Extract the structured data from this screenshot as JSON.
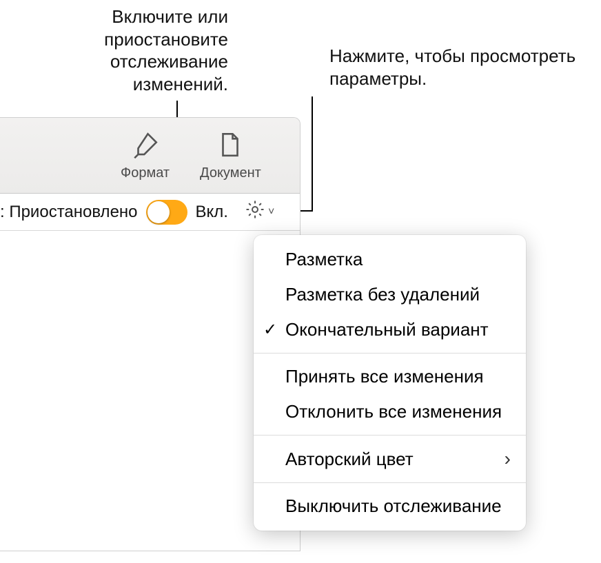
{
  "callouts": {
    "left": "Включите или приостановите отслеживание изменений.",
    "right": "Нажмите, чтобы просмотреть параметры."
  },
  "toolbar": {
    "format": "Формат",
    "document": "Документ"
  },
  "trackbar": {
    "paused": ": Приостановлено",
    "on": "Вкл."
  },
  "menu": {
    "items": {
      "markup": "Разметка",
      "markup_no_del": "Разметка без удалений",
      "final": "Окончательный вариант",
      "accept_all": "Принять все изменения",
      "reject_all": "Отклонить все изменения",
      "author_color": "Авторский цвет",
      "turn_off": "Выключить отслеживание"
    }
  }
}
